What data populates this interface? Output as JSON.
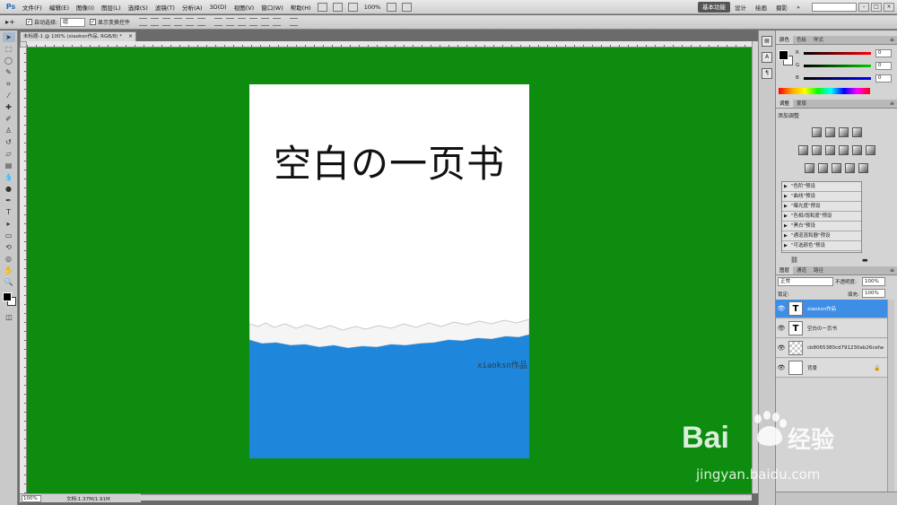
{
  "app": {
    "logo": "Ps",
    "menu": [
      "文件(F)",
      "编辑(E)",
      "图像(I)",
      "图层(L)",
      "选择(S)",
      "滤镜(T)",
      "分析(A)",
      "3D(D)",
      "视图(V)",
      "窗口(W)",
      "帮助(H)"
    ],
    "zoom_display": "100%",
    "workspaces": [
      "基本功能",
      "设计",
      "绘画",
      "摄影"
    ],
    "more_label": "»"
  },
  "options_bar": {
    "auto_select_label": "自动选择:",
    "auto_select_value": "组",
    "show_transform_label": "显示变换控件"
  },
  "document": {
    "tab_title": "未标题-1 @ 100% (xiaoksn作品, RGB/8) *",
    "tab_close": "×",
    "title_text": "空白の一页书",
    "signature": "xiaoksn作品",
    "zoom": "100%",
    "doc_size": "文档:1.37M/1.91M"
  },
  "color_panel": {
    "tabs": [
      "颜色",
      "色板",
      "样式"
    ],
    "sliders": [
      {
        "label": "R",
        "value": "0",
        "color": "#d02020"
      },
      {
        "label": "G",
        "value": "0",
        "color": "#20a020"
      },
      {
        "label": "B",
        "value": "0",
        "color": "#2040d0"
      }
    ]
  },
  "adjustments_panel": {
    "tabs": [
      "调整",
      "蒙版"
    ],
    "title": "添加调整",
    "presets": [
      "\"色阶\"预设",
      "\"曲线\"预设",
      "\"曝光度\"预设",
      "\"色相/饱和度\"预设",
      "\"黑白\"预设",
      "\"通道混和器\"预设",
      "\"可选颜色\"预设"
    ]
  },
  "layers_panel": {
    "tabs": [
      "图层",
      "通道",
      "路径"
    ],
    "blend_mode": "正常",
    "opacity_label": "不透明度:",
    "opacity_value": "100%",
    "lock_label": "锁定:",
    "fill_label": "填充:",
    "fill_value": "100%",
    "layers": [
      {
        "name": "xiaoksn作品",
        "type": "text",
        "thumb": "T",
        "selected": true
      },
      {
        "name": "空白の一页书",
        "type": "text",
        "thumb": "T",
        "selected": false
      },
      {
        "name": "cb8065380cd791230ab26cefad...",
        "type": "image",
        "thumb": "",
        "selected": false
      },
      {
        "name": "背景",
        "type": "background",
        "thumb": "",
        "selected": false
      }
    ]
  },
  "watermark": {
    "brand": "Bai",
    "brand_suffix": "经验",
    "url": "jingyan.baidu.com"
  },
  "colors": {
    "canvas_bg": "#0d8c10",
    "doc_blue": "#1e87dc",
    "selection": "#3f8ee6"
  }
}
